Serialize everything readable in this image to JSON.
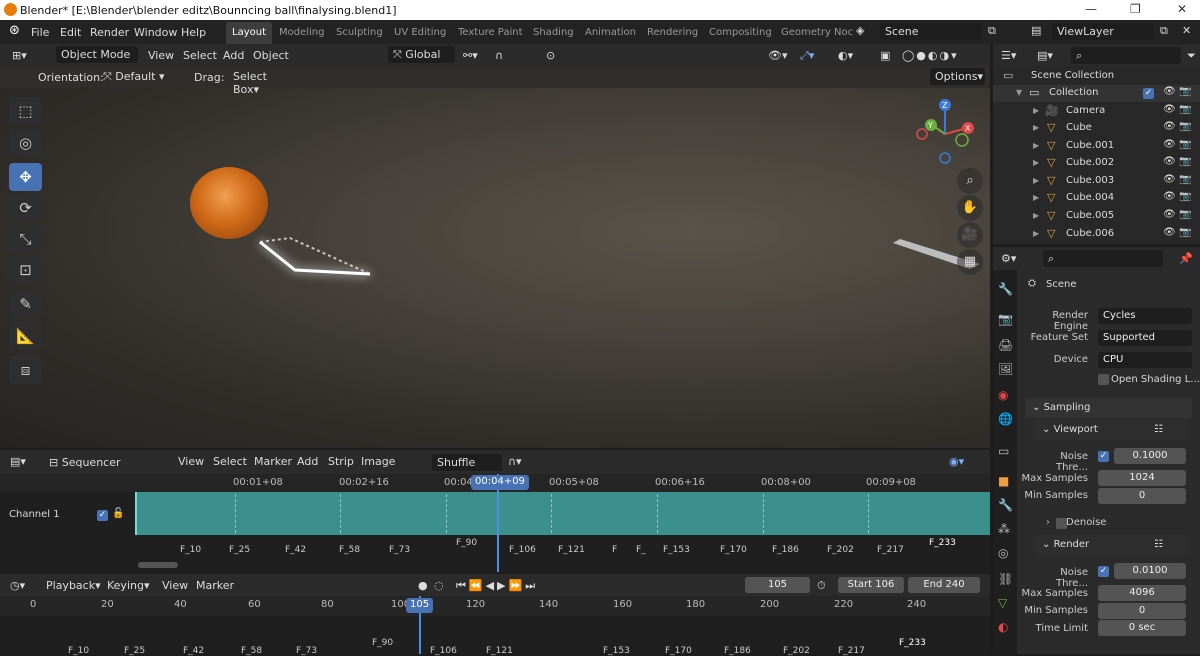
{
  "titlebar": {
    "title": "Blender* [E:\\Blender\\blender editz\\Bounncing ball\\finalysing.blend1]",
    "min": "—",
    "max": "❐",
    "close": "✕"
  },
  "menus": [
    "File",
    "Edit",
    "Render",
    "Window",
    "Help"
  ],
  "workspaces": [
    "Layout",
    "Modeling",
    "Sculpting",
    "UV Editing",
    "Texture Paint",
    "Shading",
    "Animation",
    "Rendering",
    "Compositing",
    "Geometry Noc"
  ],
  "scene_name": "Scene",
  "view_layer": "ViewLayer",
  "viewport": {
    "mode": "Object Mode",
    "menus": [
      "View",
      "Select",
      "Add",
      "Object"
    ],
    "transform": "Global",
    "orientation_label": "Orientation:",
    "orientation_value": "Default",
    "drag_label": "Drag:",
    "drag_value": "Select Box",
    "options": "Options",
    "gizmo": {
      "x": "X",
      "y": "Y",
      "z": "Z"
    }
  },
  "sequencer": {
    "editor": "Sequencer",
    "menus": [
      "View",
      "Select",
      "Marker",
      "Add",
      "Strip",
      "Image"
    ],
    "shuffle": "Shuffle",
    "ruler": [
      "00:01+08",
      "00:02+16",
      "00:04",
      "00:05+08",
      "00:06+16",
      "00:08+00",
      "00:09+08"
    ],
    "current_time": "00:04+09",
    "channel": "Channel 1",
    "markers": [
      "F_10",
      "F_25",
      "F_42",
      "F_58",
      "F_73",
      "F_90",
      "F_106",
      "F_121",
      "F",
      "F_",
      "F_153",
      "F_170",
      "F_186",
      "F_202",
      "F_217",
      "F_233"
    ]
  },
  "timeline": {
    "menus": [
      "Playback",
      "Keying",
      "View",
      "Marker"
    ],
    "current_frame": "105",
    "start_label": "Start",
    "start": "106",
    "end_label": "End",
    "end": "240",
    "ruler": [
      "0",
      "20",
      "40",
      "60",
      "80",
      "100",
      "120",
      "140",
      "160",
      "180",
      "200",
      "220",
      "240"
    ],
    "playhead": "105",
    "markers": [
      "F_10",
      "F_25",
      "F_42",
      "F_58",
      "F_73",
      "F_90",
      "F_106",
      "F_121",
      "F_153",
      "F_170",
      "F_186",
      "F_202",
      "F_217",
      "F_233"
    ]
  },
  "outliner": {
    "root": "Scene Collection",
    "collection": "Collection",
    "items": [
      "Camera",
      "Cube",
      "Cube.001",
      "Cube.002",
      "Cube.003",
      "Cube.004",
      "Cube.005",
      "Cube.006"
    ]
  },
  "properties": {
    "scene": "Scene",
    "render_engine_label": "Render Engine",
    "render_engine": "Cycles",
    "feature_set_label": "Feature Set",
    "feature_set": "Supported",
    "device_label": "Device",
    "device": "CPU",
    "open_shading": "Open Shading L...",
    "sampling": "Sampling",
    "viewport": "Viewport",
    "noise_label": "Noise Thre...",
    "vp_noise": "0.1000",
    "max_samples_label": "Max Samples",
    "vp_max": "1024",
    "min_samples_label": "Min Samples",
    "vp_min": "0",
    "denoise": "Denoise",
    "render": "Render",
    "r_noise": "0.0100",
    "r_max": "4096",
    "r_min": "0",
    "time_limit_label": "Time Limit",
    "time_limit": "0 sec"
  },
  "colors": {
    "accent": "#4772b3",
    "strip": "#3b8f8c"
  }
}
